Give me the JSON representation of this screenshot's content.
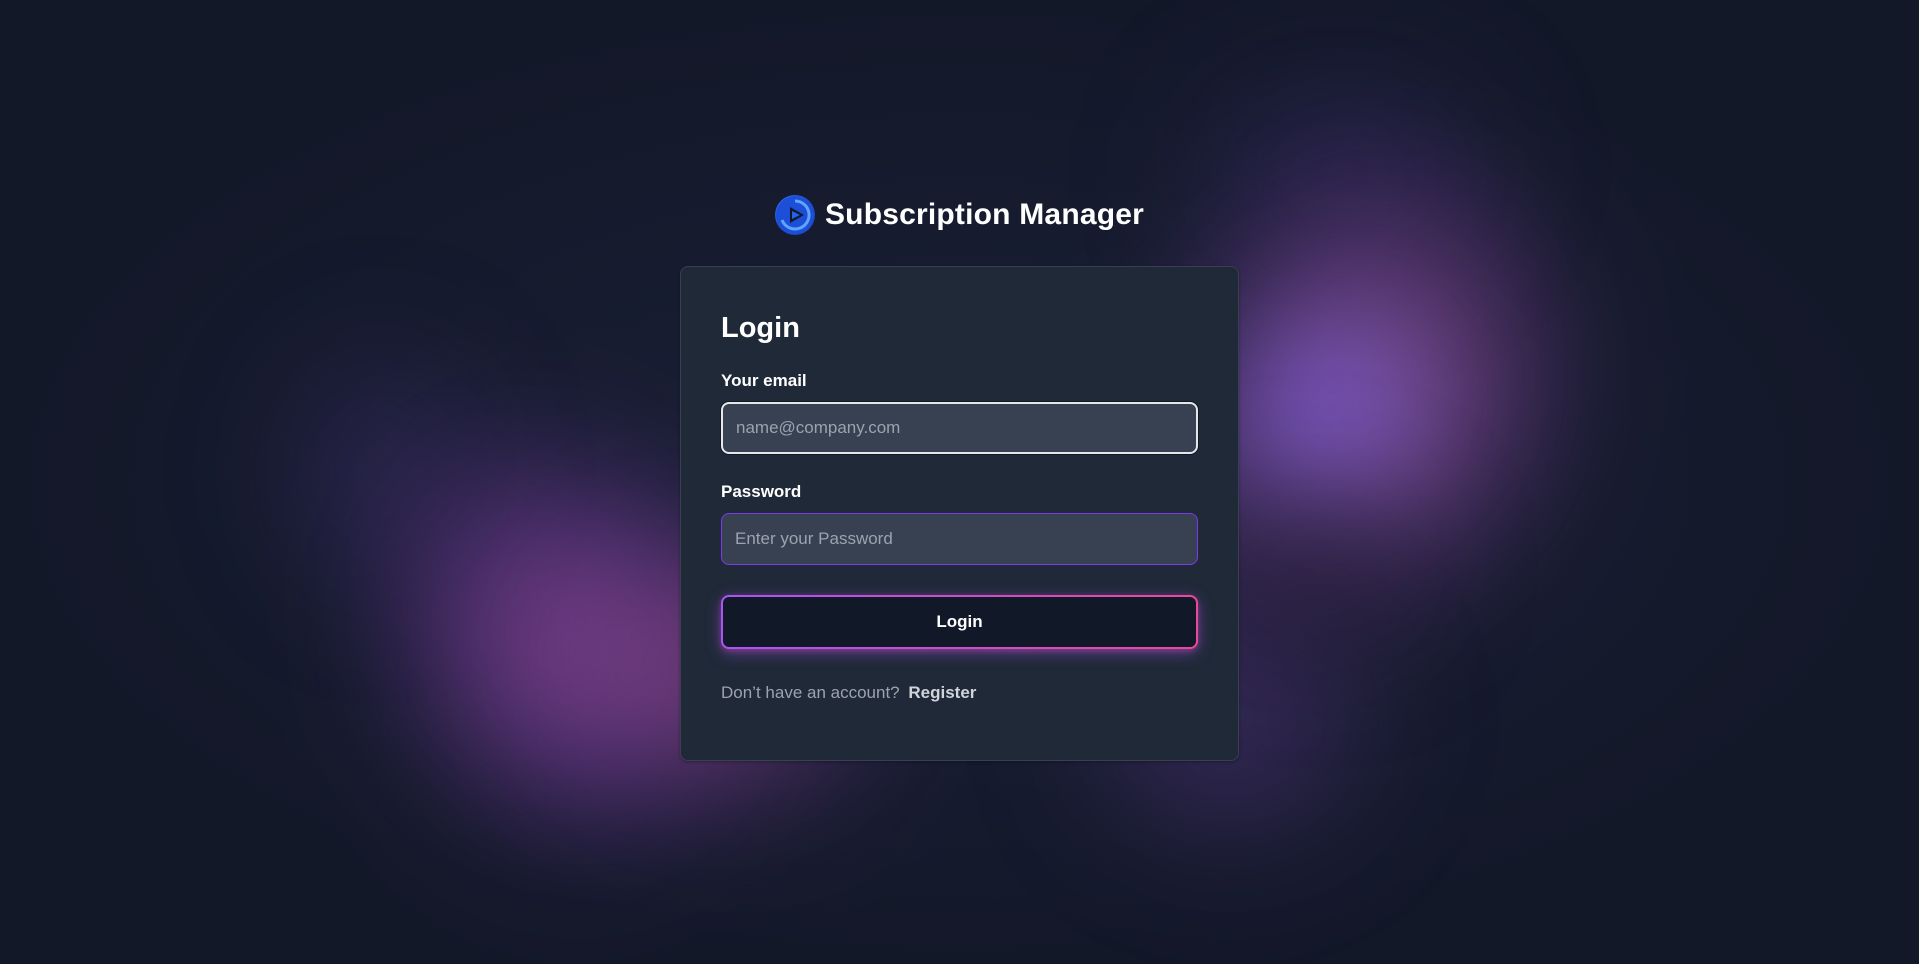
{
  "brand": {
    "title": "Subscription Manager",
    "logo_icon": "play-logo-icon"
  },
  "login_form": {
    "title": "Login",
    "email_label": "Your email",
    "email_placeholder": "name@company.com",
    "email_value": "",
    "password_label": "Password",
    "password_placeholder": "Enter your Password",
    "password_value": "",
    "submit_label": "Login",
    "no_account_text": "Don’t have an account?",
    "register_link": "Register"
  },
  "colors": {
    "background": "#141a2c",
    "card": "#1f2937",
    "input": "#374151",
    "accent_purple": "#a855f7",
    "accent_pink": "#ec4899"
  }
}
